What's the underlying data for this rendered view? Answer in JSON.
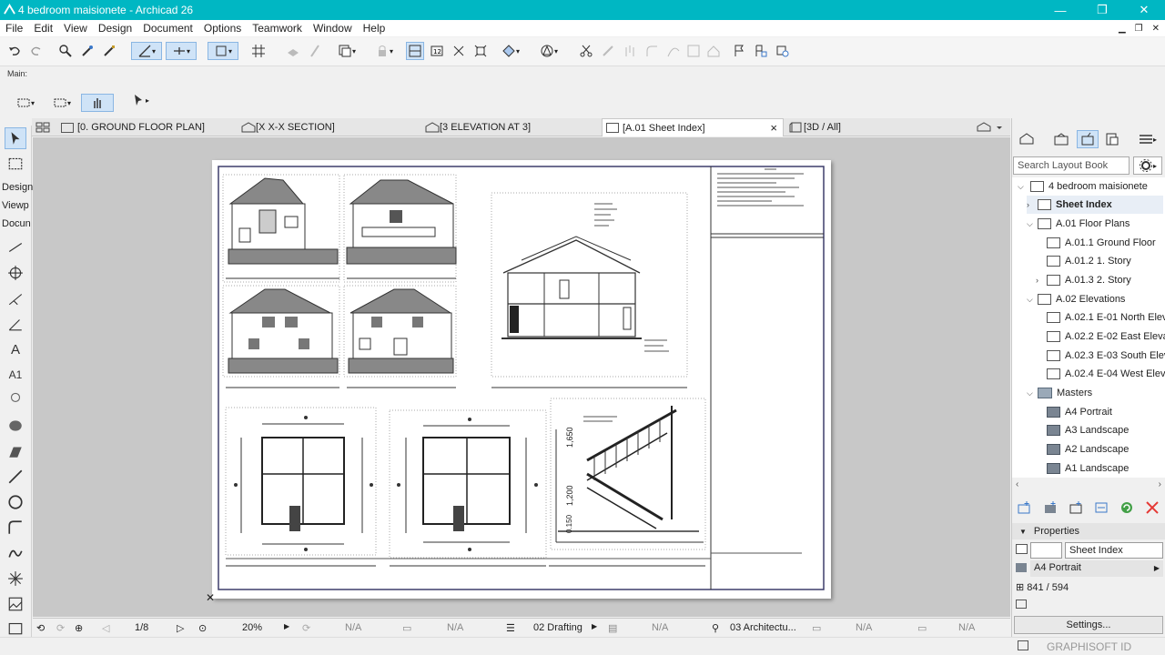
{
  "window": {
    "title": "4 bedroom maisionete - Archicad 26",
    "minimize": "—",
    "restore": "❐",
    "close": "✕"
  },
  "menu": [
    "File",
    "Edit",
    "View",
    "Design",
    "Document",
    "Options",
    "Teamwork",
    "Window",
    "Help"
  ],
  "toolbar": {
    "main_label": "Main:"
  },
  "left_toolbox": {
    "design": "Design",
    "viewpoint": "Viewp",
    "document": "Docun",
    "text_tool": "A",
    "label_tool": "A1"
  },
  "tabs": [
    {
      "label": "[0. GROUND FLOOR PLAN]"
    },
    {
      "label": "[X X-X SECTION]"
    },
    {
      "label": "[3 ELEVATION AT 3]"
    },
    {
      "label": "[A.01 Sheet Index]",
      "close": "×"
    },
    {
      "label": "[3D / All]"
    }
  ],
  "drawing": {
    "dim1": "1,650",
    "dim2": "1,200",
    "dim3": "0.150"
  },
  "status": {
    "page": "1/8",
    "zoom": "20%",
    "na1": "N/A",
    "na2": "N/A",
    "layer": "02 Drafting",
    "na3": "N/A",
    "pen_set": "03 Architectu...",
    "na4": "N/A",
    "na5": "N/A"
  },
  "navigator": {
    "search_placeholder": "Search Layout Book",
    "items": [
      {
        "label": "4 bedroom maisionete",
        "level": 0,
        "kind": "book",
        "expanded": true
      },
      {
        "label": "Sheet Index",
        "level": 1,
        "kind": "page",
        "selected": true
      },
      {
        "label": "A.01 Floor Plans",
        "level": 1,
        "kind": "folder",
        "expanded": true
      },
      {
        "label": "A.01.1 Ground Floor",
        "level": 2,
        "kind": "page"
      },
      {
        "label": "A.01.2 1. Story",
        "level": 2,
        "kind": "page"
      },
      {
        "label": "A.01.3 2. Story",
        "level": 2,
        "kind": "page"
      },
      {
        "label": "A.02 Elevations",
        "level": 1,
        "kind": "folder",
        "expanded": true
      },
      {
        "label": "A.02.1 E-01 North Eleva",
        "level": 2,
        "kind": "page"
      },
      {
        "label": "A.02.2 E-02 East Elevati",
        "level": 2,
        "kind": "page"
      },
      {
        "label": "A.02.3 E-03 South Eleva",
        "level": 2,
        "kind": "page"
      },
      {
        "label": "A.02.4 E-04 West Elevat",
        "level": 2,
        "kind": "page"
      },
      {
        "label": "Masters",
        "level": 1,
        "kind": "folder",
        "expanded": true
      },
      {
        "label": "A4 Portrait",
        "level": 2,
        "kind": "master"
      },
      {
        "label": "A3 Landscape",
        "level": 2,
        "kind": "master"
      },
      {
        "label": "A2 Landscape",
        "level": 2,
        "kind": "master"
      },
      {
        "label": "A1 Landscape",
        "level": 2,
        "kind": "master"
      }
    ]
  },
  "properties": {
    "header": "Properties",
    "name_value": "Sheet Index",
    "master": "A4 Portrait",
    "size": "841 / 594",
    "settings_label": "Settings..."
  },
  "footer": {
    "brand": "GRAPHISOFT ID"
  },
  "colors": {
    "titlebar": "#00b7c3",
    "selection": "#cfe3f7",
    "close_red": "#e53935",
    "refresh_green": "#43a047"
  }
}
